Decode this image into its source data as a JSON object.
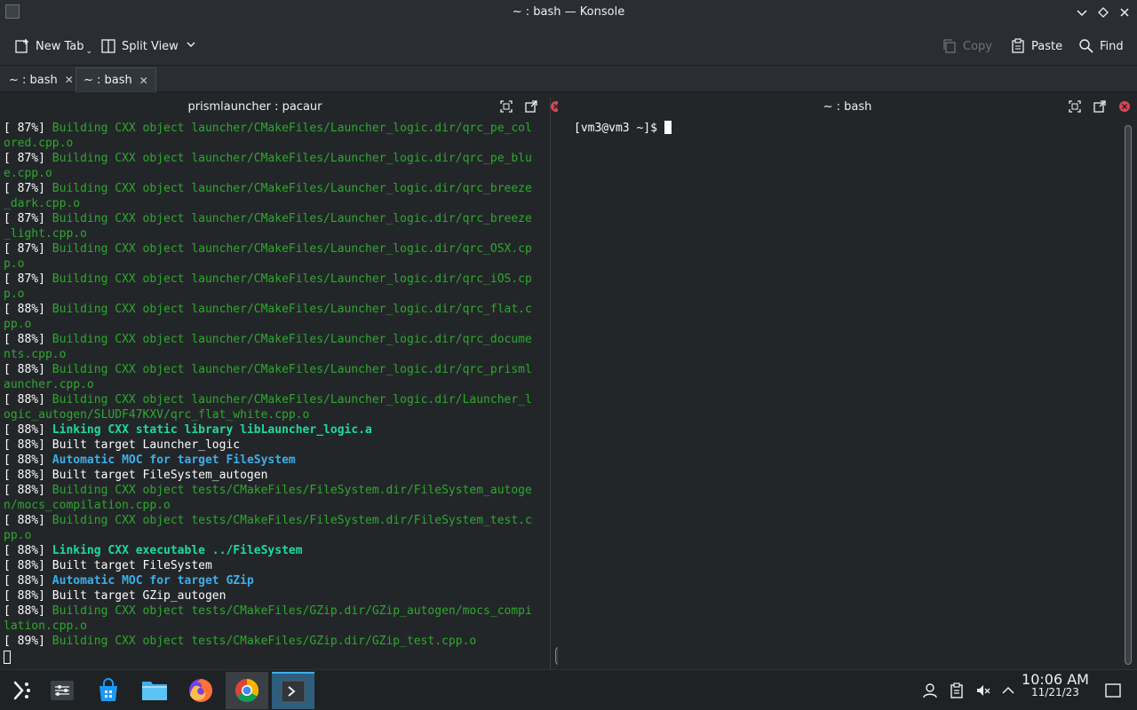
{
  "window": {
    "title": "~ : bash — Konsole"
  },
  "toolbar": {
    "new_tab_label": "New Tab",
    "split_view_label": "Split View",
    "copy_label": "Copy",
    "paste_label": "Paste",
    "find_label": "Find"
  },
  "tabs": [
    {
      "label": "~ : bash",
      "active": false
    },
    {
      "label": "~ : bash",
      "active": true
    }
  ],
  "left_pane": {
    "title": "prismlauncher : pacaur",
    "lines": [
      [
        {
          "t": "[ 87%] ",
          "c": "white"
        },
        {
          "t": "Building CXX object launcher/CMakeFiles/Launcher_logic.dir/qrc_pe_col",
          "c": "green"
        }
      ],
      [
        {
          "t": "ored.cpp.o",
          "c": "green"
        }
      ],
      [
        {
          "t": "[ 87%] ",
          "c": "white"
        },
        {
          "t": "Building CXX object launcher/CMakeFiles/Launcher_logic.dir/qrc_pe_blu",
          "c": "green"
        }
      ],
      [
        {
          "t": "e.cpp.o",
          "c": "green"
        }
      ],
      [
        {
          "t": "[ 87%] ",
          "c": "white"
        },
        {
          "t": "Building CXX object launcher/CMakeFiles/Launcher_logic.dir/qrc_breeze",
          "c": "green"
        }
      ],
      [
        {
          "t": "_dark.cpp.o",
          "c": "green"
        }
      ],
      [
        {
          "t": "[ 87%] ",
          "c": "white"
        },
        {
          "t": "Building CXX object launcher/CMakeFiles/Launcher_logic.dir/qrc_breeze",
          "c": "green"
        }
      ],
      [
        {
          "t": "_light.cpp.o",
          "c": "green"
        }
      ],
      [
        {
          "t": "[ 87%] ",
          "c": "white"
        },
        {
          "t": "Building CXX object launcher/CMakeFiles/Launcher_logic.dir/qrc_OSX.cp",
          "c": "green"
        }
      ],
      [
        {
          "t": "p.o",
          "c": "green"
        }
      ],
      [
        {
          "t": "[ 87%] ",
          "c": "white"
        },
        {
          "t": "Building CXX object launcher/CMakeFiles/Launcher_logic.dir/qrc_iOS.cp",
          "c": "green"
        }
      ],
      [
        {
          "t": "p.o",
          "c": "green"
        }
      ],
      [
        {
          "t": "[ 88%] ",
          "c": "white"
        },
        {
          "t": "Building CXX object launcher/CMakeFiles/Launcher_logic.dir/qrc_flat.c",
          "c": "green"
        }
      ],
      [
        {
          "t": "pp.o",
          "c": "green"
        }
      ],
      [
        {
          "t": "[ 88%] ",
          "c": "white"
        },
        {
          "t": "Building CXX object launcher/CMakeFiles/Launcher_logic.dir/qrc_docume",
          "c": "green"
        }
      ],
      [
        {
          "t": "nts.cpp.o",
          "c": "green"
        }
      ],
      [
        {
          "t": "[ 88%] ",
          "c": "white"
        },
        {
          "t": "Building CXX object launcher/CMakeFiles/Launcher_logic.dir/qrc_prisml",
          "c": "green"
        }
      ],
      [
        {
          "t": "auncher.cpp.o",
          "c": "green"
        }
      ],
      [
        {
          "t": "[ 88%] ",
          "c": "white"
        },
        {
          "t": "Building CXX object launcher/CMakeFiles/Launcher_logic.dir/Launcher_l",
          "c": "green"
        }
      ],
      [
        {
          "t": "ogic_autogen/SLUDF47KXV/qrc_flat_white.cpp.o",
          "c": "green"
        }
      ],
      [
        {
          "t": "[ 88%] ",
          "c": "white"
        },
        {
          "t": "Linking CXX static library libLauncher_logic.a",
          "c": "boldgreen"
        }
      ],
      [
        {
          "t": "[ 88%] Built target Launcher_logic",
          "c": "white"
        }
      ],
      [
        {
          "t": "[ 88%] ",
          "c": "white"
        },
        {
          "t": "Automatic MOC for target FileSystem",
          "c": "boldblue"
        }
      ],
      [
        {
          "t": "[ 88%] Built target FileSystem_autogen",
          "c": "white"
        }
      ],
      [
        {
          "t": "[ 88%] ",
          "c": "white"
        },
        {
          "t": "Building CXX object tests/CMakeFiles/FileSystem.dir/FileSystem_autoge",
          "c": "green"
        }
      ],
      [
        {
          "t": "n/mocs_compilation.cpp.o",
          "c": "green"
        }
      ],
      [
        {
          "t": "[ 88%] ",
          "c": "white"
        },
        {
          "t": "Building CXX object tests/CMakeFiles/FileSystem.dir/FileSystem_test.c",
          "c": "green"
        }
      ],
      [
        {
          "t": "pp.o",
          "c": "green"
        }
      ],
      [
        {
          "t": "[ 88%] ",
          "c": "white"
        },
        {
          "t": "Linking CXX executable ../FileSystem",
          "c": "boldgreen"
        }
      ],
      [
        {
          "t": "[ 88%] Built target FileSystem",
          "c": "white"
        }
      ],
      [
        {
          "t": "[ 88%] ",
          "c": "white"
        },
        {
          "t": "Automatic MOC for target GZip",
          "c": "boldblue"
        }
      ],
      [
        {
          "t": "[ 88%] Built target GZip_autogen",
          "c": "white"
        }
      ],
      [
        {
          "t": "[ 88%] ",
          "c": "white"
        },
        {
          "t": "Building CXX object tests/CMakeFiles/GZip.dir/GZip_autogen/mocs_compi",
          "c": "green"
        }
      ],
      [
        {
          "t": "lation.cpp.o",
          "c": "green"
        }
      ],
      [
        {
          "t": "[ 89%] ",
          "c": "white"
        },
        {
          "t": "Building CXX object tests/CMakeFiles/GZip.dir/GZip_test.cpp.o",
          "c": "green"
        }
      ]
    ]
  },
  "right_pane": {
    "title": "~ : bash",
    "prompt": "[vm3@vm3 ~]$ "
  },
  "taskbar": {
    "apps": [
      {
        "name": "application-launcher"
      },
      {
        "name": "system-settings"
      },
      {
        "name": "discover-store"
      },
      {
        "name": "dolphin-file-manager"
      },
      {
        "name": "firefox"
      },
      {
        "name": "chrome"
      },
      {
        "name": "konsole"
      }
    ],
    "clock_time": "10:06 AM",
    "clock_date": "11/21/23"
  },
  "colors": {
    "white": "#fcfcfc",
    "green": "#2ea82e",
    "boldgreen": "#1cdc9a",
    "boldblue": "#3daee9",
    "accent": "#3daee9",
    "close_red": "#da4453"
  }
}
